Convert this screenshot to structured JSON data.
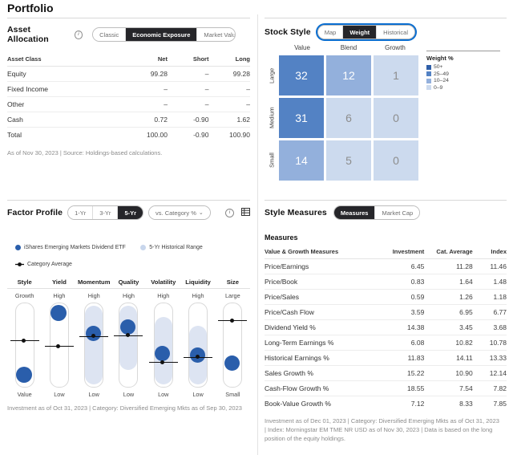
{
  "page_title": "Portfolio",
  "asset_allocation": {
    "title": "Asset Allocation",
    "info_icon": "info-icon",
    "tabs": [
      {
        "label": "Classic",
        "active": false
      },
      {
        "label": "Economic Exposure",
        "active": true
      },
      {
        "label": "Market Value",
        "active": false
      }
    ],
    "columns": [
      "Asset Class",
      "Net",
      "Short",
      "Long"
    ],
    "rows": [
      {
        "name": "Equity",
        "net": "99.28",
        "short": "–",
        "long": "99.28"
      },
      {
        "name": "Fixed Income",
        "net": "–",
        "short": "–",
        "long": "–"
      },
      {
        "name": "Other",
        "net": "–",
        "short": "–",
        "long": "–"
      },
      {
        "name": "Cash",
        "net": "0.72",
        "short": "-0.90",
        "long": "1.62"
      },
      {
        "name": "Total",
        "net": "100.00",
        "short": "-0.90",
        "long": "100.90"
      }
    ],
    "footnote": "As of Nov 30, 2023 | Source: Holdings-based calculations."
  },
  "stock_style": {
    "title": "Stock Style",
    "tabs": [
      {
        "label": "Map",
        "active": false
      },
      {
        "label": "Weight",
        "active": true
      },
      {
        "label": "Historical",
        "active": false
      }
    ],
    "col_headers": [
      "Value",
      "Blend",
      "Growth"
    ],
    "row_headers": [
      "Large",
      "Medium",
      "Small"
    ],
    "cells": [
      [
        {
          "value": "32",
          "bucket": "25-49"
        },
        {
          "value": "12",
          "bucket": "10-24"
        },
        {
          "value": "1",
          "bucket": "0-9"
        }
      ],
      [
        {
          "value": "31",
          "bucket": "25-49"
        },
        {
          "value": "6",
          "bucket": "0-9"
        },
        {
          "value": "0",
          "bucket": "0-9"
        }
      ],
      [
        {
          "value": "14",
          "bucket": "10-24"
        },
        {
          "value": "5",
          "bucket": "0-9"
        },
        {
          "value": "0",
          "bucket": "0-9"
        }
      ]
    ],
    "legend_title": "Weight %",
    "legend": [
      {
        "label": "50+",
        "color": "#2f5fa8"
      },
      {
        "label": "25–49",
        "color": "#5382c4"
      },
      {
        "label": "10–24",
        "color": "#93b0dc"
      },
      {
        "label": "0–9",
        "color": "#ccdaee"
      }
    ],
    "bucket_colors": {
      "50+": "#2f5fa8",
      "25-49": "#5382c4",
      "10-24": "#93b0dc",
      "0-9": "#ccdaee"
    },
    "text_colors": {
      "50+": "#ffffff",
      "25-49": "#ffffff",
      "10-24": "#ffffff",
      "0-9": "#8d8d8d"
    }
  },
  "factor_profile": {
    "title": "Factor Profile",
    "period_tabs": [
      {
        "label": "1-Yr",
        "active": false
      },
      {
        "label": "3-Yr",
        "active": false
      },
      {
        "label": "5-Yr",
        "active": true
      }
    ],
    "compare_dropdown": "vs. Category %",
    "info_icon": "info-icon",
    "table_icon": "table-view-icon",
    "legend": [
      {
        "type": "dot",
        "color": "#2a5eab",
        "label": "iShares Emerging Markets Dividend ETF"
      },
      {
        "type": "dot",
        "color": "#c8d6ec",
        "label": "5-Yr Historical Range"
      },
      {
        "type": "line",
        "color": "#111111",
        "label": "Category Average"
      }
    ],
    "factors": [
      {
        "name": "Style",
        "top_label": "Growth",
        "bottom_label": "Value",
        "bubble_pos": 0.86,
        "bubble_size": 20,
        "range_top": null,
        "range_bottom": null,
        "avg_pos": 0.44
      },
      {
        "name": "Yield",
        "top_label": "High",
        "bottom_label": "Low",
        "bubble_pos": 0.12,
        "bubble_size": 20,
        "range_top": null,
        "range_bottom": null,
        "avg_pos": 0.51
      },
      {
        "name": "Momentum",
        "top_label": "High",
        "bottom_label": "Low",
        "bubble_pos": 0.36,
        "bubble_size": 19,
        "range_top": 0.03,
        "range_bottom": 0.97,
        "avg_pos": 0.39
      },
      {
        "name": "Quality",
        "top_label": "High",
        "bottom_label": "Low",
        "bubble_pos": 0.28,
        "bubble_size": 19,
        "range_top": 0.03,
        "range_bottom": 0.8,
        "avg_pos": 0.38
      },
      {
        "name": "Volatility",
        "top_label": "High",
        "bottom_label": "Low",
        "bubble_pos": 0.6,
        "bubble_size": 19,
        "range_top": 0.16,
        "range_bottom": 0.97,
        "avg_pos": 0.7
      },
      {
        "name": "Liquidity",
        "top_label": "High",
        "bottom_label": "Low",
        "bubble_pos": 0.62,
        "bubble_size": 19,
        "range_top": 0.27,
        "range_bottom": 0.97,
        "avg_pos": 0.64
      },
      {
        "name": "Size",
        "top_label": "Large",
        "bottom_label": "Small",
        "bubble_pos": 0.72,
        "bubble_size": 19,
        "range_top": null,
        "range_bottom": null,
        "avg_pos": 0.2
      }
    ],
    "footnote": "Investment as of Oct 31, 2023 | Category: Diversified Emerging Mkts as of Sep 30, 2023"
  },
  "style_measures": {
    "title": "Style Measures",
    "tabs": [
      {
        "label": "Measures",
        "active": true
      },
      {
        "label": "Market Cap",
        "active": false
      }
    ],
    "subtitle": "Measures",
    "columns": [
      "Value & Growth Measures",
      "Investment",
      "Cat. Average",
      "Index"
    ],
    "rows": [
      {
        "name": "Price/Earnings",
        "investment": "6.45",
        "cat": "11.28",
        "index": "11.46"
      },
      {
        "name": "Price/Book",
        "investment": "0.83",
        "cat": "1.64",
        "index": "1.48"
      },
      {
        "name": "Price/Sales",
        "investment": "0.59",
        "cat": "1.26",
        "index": "1.18"
      },
      {
        "name": "Price/Cash Flow",
        "investment": "3.59",
        "cat": "6.95",
        "index": "6.77"
      },
      {
        "name": "Dividend Yield %",
        "investment": "14.38",
        "cat": "3.45",
        "index": "3.68"
      },
      {
        "name": "Long-Term Earnings %",
        "investment": "6.08",
        "cat": "10.82",
        "index": "10.78"
      },
      {
        "name": "Historical Earnings %",
        "investment": "11.83",
        "cat": "14.11",
        "index": "13.33"
      },
      {
        "name": "Sales Growth %",
        "investment": "15.22",
        "cat": "10.90",
        "index": "12.14"
      },
      {
        "name": "Cash-Flow Growth %",
        "investment": "18.55",
        "cat": "7.54",
        "index": "7.82"
      },
      {
        "name": "Book-Value Growth %",
        "investment": "7.12",
        "cat": "8.33",
        "index": "7.85"
      }
    ],
    "footnote": "Investment as of Dec 01, 2023 | Category: Diversified Emerging Mkts as of Oct 31, 2023 | Index: Morningstar EM TME NR USD as of Nov 30, 2023 | Data is based on the long position of the equity holdings."
  }
}
